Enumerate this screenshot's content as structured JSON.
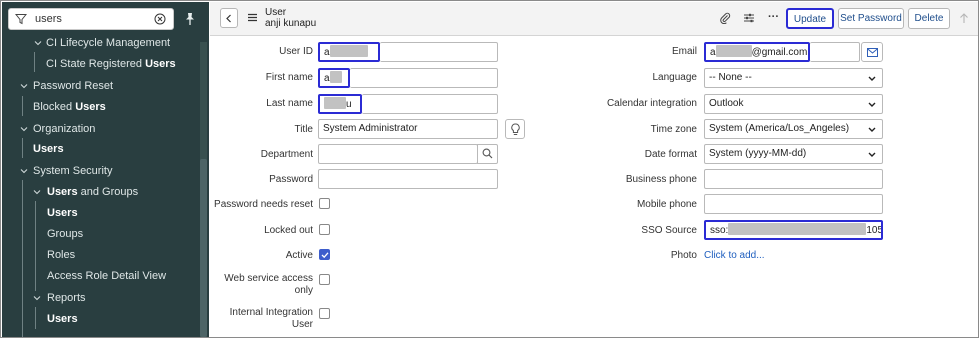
{
  "nav": {
    "search_value": "users",
    "items": [
      {
        "text": "CI Lifecycle Management",
        "bold": ""
      },
      {
        "text": "CI State Registered ",
        "bold": "Users"
      },
      {
        "text": "Password Reset",
        "bold": ""
      },
      {
        "text": "Blocked ",
        "bold": "Users"
      },
      {
        "text": "Organization",
        "bold": ""
      },
      {
        "text": "",
        "bold": "Users"
      },
      {
        "text": "System Security",
        "bold": ""
      },
      {
        "text": " and Groups",
        "bold": "Users"
      },
      {
        "text": "",
        "bold": "Users"
      },
      {
        "text": "Groups",
        "bold": ""
      },
      {
        "text": "Roles",
        "bold": ""
      },
      {
        "text": "Access Role Detail View",
        "bold": ""
      },
      {
        "text": "Reports",
        "bold": ""
      },
      {
        "text": "",
        "bold": "Users"
      }
    ]
  },
  "header": {
    "record_type": "User",
    "record_name": "anji kunapu",
    "update_label": "Update",
    "set_password_label": "Set Password",
    "delete_label": "Delete",
    "more_label": "···"
  },
  "form": {
    "left": {
      "user_id_label": "User ID",
      "user_id_value": "a",
      "first_name_label": "First name",
      "first_name_value": "a",
      "last_name_label": "Last name",
      "last_name_value": "u",
      "title_label": "Title",
      "title_value": "System Administrator",
      "department_label": "Department",
      "department_value": "",
      "password_label": "Password",
      "password_needs_reset_label": "Password needs reset",
      "locked_out_label": "Locked out",
      "active_label": "Active",
      "web_service_label_1": "Web service access",
      "web_service_label_2": "only",
      "internal_integration_label_1": "Internal Integration",
      "internal_integration_label_2": "User"
    },
    "right": {
      "email_label": "Email",
      "email_prefix": "a",
      "email_suffix": "@gmail.com",
      "language_label": "Language",
      "language_value": "-- None --",
      "calendar_label": "Calendar integration",
      "calendar_value": "Outlook",
      "timezone_label": "Time zone",
      "timezone_value": "System (America/Los_Angeles)",
      "date_format_label": "Date format",
      "date_format_value": "System (yyyy-MM-dd)",
      "business_phone_label": "Business phone",
      "mobile_phone_label": "Mobile phone",
      "sso_label": "SSO Source",
      "sso_prefix": "sso:",
      "sso_suffix": "105",
      "photo_label": "Photo",
      "photo_link": "Click to add..."
    }
  },
  "colors": {
    "nav_bg": "#293e40",
    "highlight": "#2b2bd4",
    "link": "#1f5fbf",
    "checkbox_on": "#3d5dcc"
  }
}
